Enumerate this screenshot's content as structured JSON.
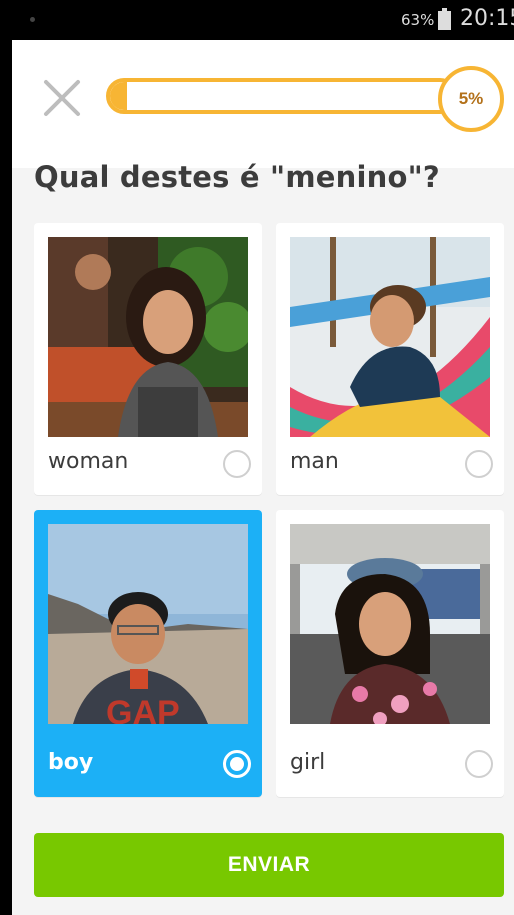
{
  "status_bar": {
    "battery_percent": "63%",
    "time": "20:15"
  },
  "lesson": {
    "progress_percent": 5,
    "progress_label": "5%",
    "question": "Qual destes é \"menino\"?"
  },
  "choices": [
    {
      "label": "woman",
      "selected": false,
      "image": "smiling woman at outdoor table"
    },
    {
      "label": "man",
      "selected": false,
      "image": "man lying in colorful hammock"
    },
    {
      "label": "boy",
      "selected": true,
      "image": "boy in red hoodie in desert"
    },
    {
      "label": "girl",
      "selected": false,
      "image": "girl in hat sitting in car"
    }
  ],
  "submit_label": "ENVIAR",
  "colors": {
    "accent_progress": "#f7b534",
    "selected_card": "#1cb0f6",
    "submit_button": "#78c800"
  },
  "icons": {
    "close": "close-icon",
    "battery": "battery-icon"
  }
}
